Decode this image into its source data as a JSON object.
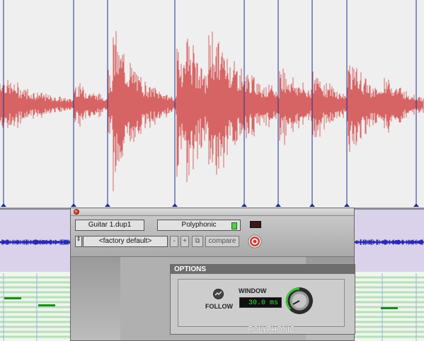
{
  "editor": {
    "waveform_color": "#d76464",
    "marker_color": "#1f2f8f",
    "lane_color": "#d9d2ea",
    "midi_note_color": "#1c8a1c"
  },
  "plugin": {
    "track_name": "Guitar 1.dup1",
    "mode": "Polyphonic",
    "preset_arrows": "⇕",
    "preset": "<factory default>",
    "minus_label": "-",
    "plus_label": "+",
    "copy_label": "⧉",
    "compare_label": "compare",
    "options_title": "OPTIONS",
    "follow_label": "FOLLOW",
    "window_label": "WINDOW",
    "window_value": "30.0 ms",
    "brand": "POLYPHONIC"
  }
}
